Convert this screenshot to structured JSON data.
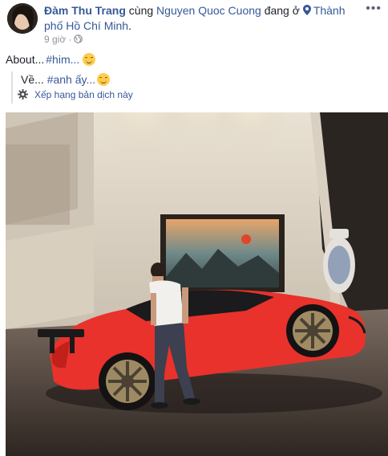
{
  "post": {
    "author": "Đàm Thu Trang",
    "with_word": " cùng ",
    "tagged": "Nguyen Quoc Cuong",
    "at_word": " đang ở ",
    "location": "Thành phố Hồ Chí Minh",
    "suffix": ".",
    "time": "9 giờ",
    "separator": "·",
    "more_label": "•••",
    "status_prefix": "About... ",
    "status_hashtag": "#him...",
    "translation_prefix": "Về... ",
    "translation_hashtag": "#anh ấy...",
    "rate_translation": "Xếp hạng bản dịch này"
  },
  "icons": {
    "location": "map-pin-icon",
    "privacy": "globe-icon",
    "settings": "gear-icon",
    "emoji": "smiling-face-emoji"
  },
  "colors": {
    "link": "#365899",
    "text": "#1d2129",
    "meta": "#90949c",
    "car": "#e8322b"
  }
}
